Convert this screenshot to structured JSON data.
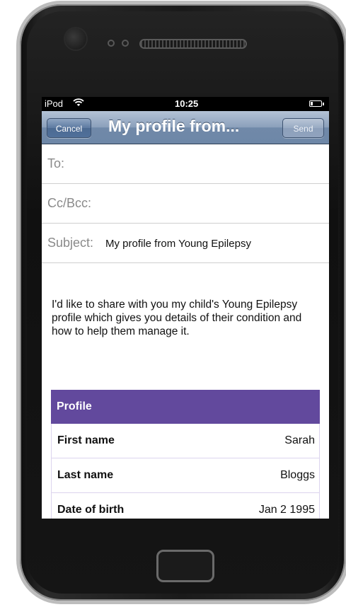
{
  "status_bar": {
    "carrier": "iPod",
    "time": "10:25",
    "battery_level": 0.2
  },
  "nav": {
    "cancel_label": "Cancel",
    "title": "My profile from...",
    "send_label": "Send"
  },
  "compose": {
    "to_label": "To:",
    "cc_label": "Cc/Bcc:",
    "subject_label": "Subject:",
    "subject_value": "My profile from Young Epilepsy",
    "body": "I'd like to share with you my child's Young Epilepsy profile which gives you details of their condition and how to help them manage it."
  },
  "profile_table": {
    "header": "Profile",
    "rows": [
      {
        "label": "First name",
        "value": "Sarah"
      },
      {
        "label": "Last name",
        "value": "Bloggs"
      },
      {
        "label": "Date of birth",
        "value": "Jan 2 1995"
      }
    ]
  },
  "colors": {
    "profile_header": "#62499d",
    "navbar": "#7089a9"
  }
}
